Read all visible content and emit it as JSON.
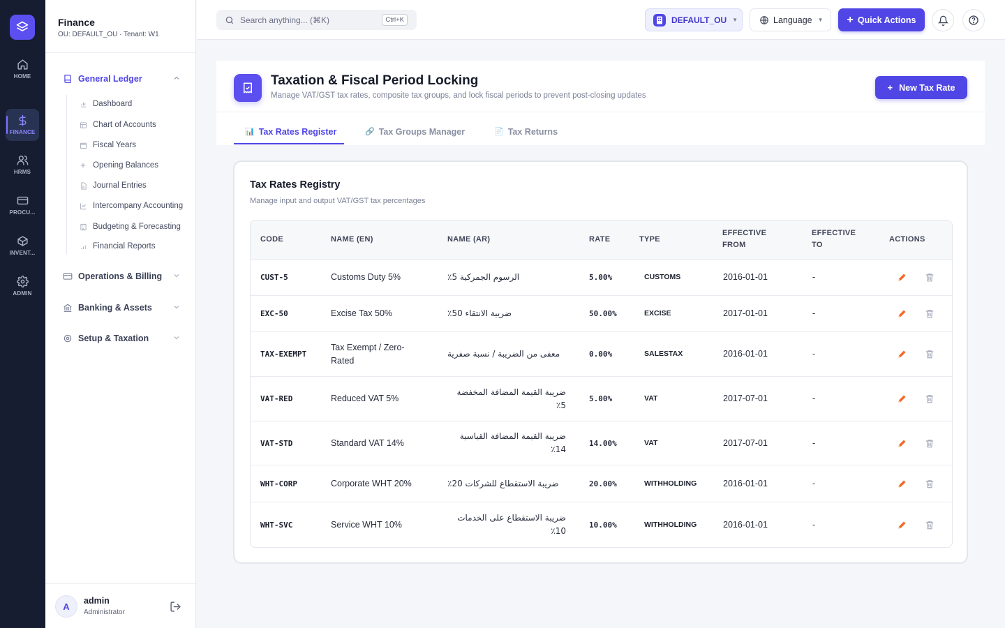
{
  "rail": {
    "items": [
      {
        "label": "HOME",
        "icon": "home-icon"
      },
      {
        "label": "FINANCE",
        "icon": "dollar-icon",
        "active": true
      },
      {
        "label": "HRMS",
        "icon": "users-icon"
      },
      {
        "label": "PROCU...",
        "icon": "card-icon"
      },
      {
        "label": "INVENT...",
        "icon": "box-icon"
      },
      {
        "label": "ADMIN",
        "icon": "gear-icon"
      }
    ]
  },
  "sidebar": {
    "title": "Finance",
    "subtitle": "OU: DEFAULT_OU · Tenant: W1",
    "groups": [
      {
        "label": "General Ledger",
        "open": true
      },
      {
        "label": "Operations & Billing"
      },
      {
        "label": "Banking & Assets"
      },
      {
        "label": "Setup & Taxation"
      }
    ],
    "subitems": [
      "Dashboard",
      "Chart of Accounts",
      "Fiscal Years",
      "Opening Balances",
      "Journal Entries",
      "Intercompany Accounting",
      "Budgeting & Forecasting",
      "Financial Reports"
    ],
    "user": {
      "initial": "A",
      "name": "admin",
      "role": "Administrator"
    }
  },
  "topbar": {
    "search_placeholder": "Search anything... (⌘K)",
    "search_shortcut": "Ctrl+K",
    "ou_label": "DEFAULT_OU",
    "language_label": "Language",
    "quick_actions_label": "Quick Actions"
  },
  "page": {
    "title": "Taxation & Fiscal Period Locking",
    "subtitle": "Manage VAT/GST tax rates, composite tax groups, and lock fiscal periods to prevent post-closing updates",
    "new_button": "New Tax Rate",
    "tabs": [
      {
        "label": "Tax Rates Register",
        "icon": "📊",
        "active": true
      },
      {
        "label": "Tax Groups Manager",
        "icon": "🔗"
      },
      {
        "label": "Tax Returns",
        "icon": "📄"
      }
    ]
  },
  "registry": {
    "title": "Tax Rates Registry",
    "subtitle": "Manage input and output VAT/GST tax percentages",
    "columns": {
      "code": "CODE",
      "name_en": "NAME (EN)",
      "name_ar": "NAME (AR)",
      "rate": "RATE",
      "type": "TYPE",
      "from_1": "EFFECTIVE",
      "from_2": "FROM",
      "to_1": "EFFECTIVE",
      "to_2": "TO",
      "actions": "ACTIONS"
    },
    "rows": [
      {
        "code": "CUST-5",
        "name_en": "Customs Duty 5%",
        "name_ar": "الرسوم الجمركية 5٪",
        "rate": "5.00%",
        "type": "CUSTOMS",
        "from": "2016-01-01",
        "to": "-"
      },
      {
        "code": "EXC-50",
        "name_en": "Excise Tax 50%",
        "name_ar": "ضريبة الانتقاء 50٪",
        "rate": "50.00%",
        "type": "EXCISE",
        "from": "2017-01-01",
        "to": "-"
      },
      {
        "code": "TAX-EXEMPT",
        "name_en": "Tax Exempt / Zero-Rated",
        "name_ar": "معفى من الضريبة / نسبة صفرية",
        "rate": "0.00%",
        "type": "SALESTAX",
        "from": "2016-01-01",
        "to": "-"
      },
      {
        "code": "VAT-RED",
        "name_en": "Reduced VAT 5%",
        "name_ar": "ضريبة القيمة المضافة المخفضة 5٪",
        "rate": "5.00%",
        "type": "VAT",
        "from": "2017-07-01",
        "to": "-"
      },
      {
        "code": "VAT-STD",
        "name_en": "Standard VAT 14%",
        "name_ar": "ضريبة القيمة المضافة القياسية 14٪",
        "rate": "14.00%",
        "type": "VAT",
        "from": "2017-07-01",
        "to": "-"
      },
      {
        "code": "WHT-CORP",
        "name_en": "Corporate WHT 20%",
        "name_ar": "ضريبة الاستقطاع للشركات 20٪",
        "rate": "20.00%",
        "type": "WITHHOLDING",
        "from": "2016-01-01",
        "to": "-"
      },
      {
        "code": "WHT-SVC",
        "name_en": "Service WHT 10%",
        "name_ar": "ضريبة الاستقطاع على الخدمات 10٪",
        "rate": "10.00%",
        "type": "WITHHOLDING",
        "from": "2016-01-01",
        "to": "-"
      }
    ]
  },
  "colors": {
    "accent": "#4f46e5",
    "rail_bg": "#161d30",
    "edit_icon": "#f26b2b",
    "delete_icon": "#a7acba"
  }
}
